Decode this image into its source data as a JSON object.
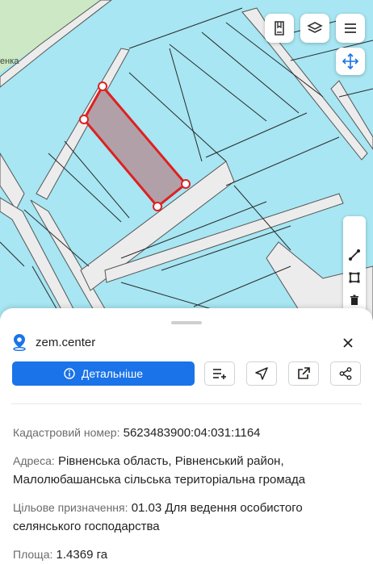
{
  "map": {
    "place_label": "енка",
    "colors": {
      "water_parcel": "#a7e6f2",
      "land": "#ececec",
      "forest": "#cde8c4",
      "selection_stroke": "#e02020",
      "selection_fill": "#b2a0a8"
    },
    "buttons": [
      {
        "name": "bookmark-icon"
      },
      {
        "name": "layers-icon"
      },
      {
        "name": "menu-icon"
      },
      {
        "name": "move-icon"
      }
    ],
    "tools": [
      {
        "name": "line-tool-icon"
      },
      {
        "name": "polygon-tool-icon"
      },
      {
        "name": "trash-icon"
      }
    ]
  },
  "sheet": {
    "brand": "zem.center",
    "details_label": "Детальніше",
    "actions": [
      "add-to-list-icon",
      "navigate-icon",
      "open-external-icon",
      "share-icon"
    ],
    "cadastral": {
      "label": "Кадастровий номер:",
      "value": "5623483900:04:031:1164"
    },
    "address": {
      "label": "Адреса:",
      "line1": "Рівненська область, Рівненський район,",
      "line2": "Малолюбашанська сільська територіальна громада"
    },
    "purpose": {
      "label": "Цільове призначення:",
      "line1": "01.03 Для ведення особистого",
      "line2": "селянського господарства"
    },
    "area": {
      "label": "Площа:",
      "value": "1.4369 га"
    }
  }
}
